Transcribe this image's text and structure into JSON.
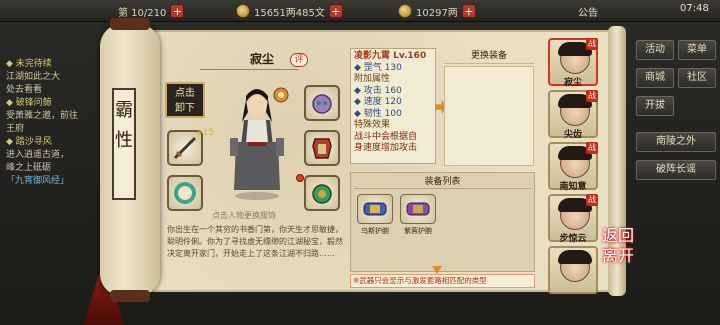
{
  "topbar": {
    "level_text": "第 10/210",
    "silver": "15651两485文",
    "gold": "10297两",
    "announcement": "公告",
    "clock": "07:48"
  },
  "quest_panel": {
    "lines": [
      {
        "text": "◆ 未完待续",
        "cls": "h"
      },
      {
        "text": "江湖如此之大",
        "cls": ""
      },
      {
        "text": "处去看看",
        "cls": ""
      },
      {
        "text": "◆ 破锋问鲸",
        "cls": "h"
      },
      {
        "text": "受萧雅之邀，前往",
        "cls": ""
      },
      {
        "text": "王府",
        "cls": ""
      },
      {
        "text": "◆ 踏沙寻风",
        "cls": "h"
      },
      {
        "text": "进入逍遥古道，",
        "cls": ""
      },
      {
        "text": "峰之上砥砺",
        "cls": ""
      },
      {
        "text": "「九宵御风经」",
        "cls": "hl"
      }
    ]
  },
  "right_menu": {
    "row1": [
      "活动",
      "菜单"
    ],
    "row2": [
      "商城",
      "社区"
    ],
    "btn3": "开拔",
    "side1": "南陵之外",
    "side2": "破阵长谣"
  },
  "character": {
    "vertical_title": "霸性",
    "name": "寂尘",
    "rate_label": "评",
    "unload_label_1": "点击",
    "unload_label_2": "卸下",
    "upgrade_badge": "+15",
    "hint": "点击人物更换服饰",
    "description": "你出生在一个其穷的书香门第，你天生才思敏捷，聪明伶俐。你为了寻找虚无缥缈的江湖秘宝，毅然决定离开家门，开始走上了这条江湖不归路……"
  },
  "item_detail": {
    "title": "凌影九霄 Lv.160",
    "base": "◆ 罡气 130",
    "extra_head": "附加属性",
    "stats": [
      "◆ 攻击 160",
      "◆ 速度 120",
      "◆ 韧性 100"
    ],
    "special_head": "特殊效果",
    "effect_1": "战斗中会根据自",
    "effect_2": "身速度增加攻击"
  },
  "replace": {
    "header": "更换装备"
  },
  "equip_list": {
    "title": "装备列表",
    "items": [
      {
        "name": "乌斯护腕"
      },
      {
        "name": "紫蓉护腕"
      }
    ],
    "note": "※武器只会显示与激发套路相匹配的类型"
  },
  "roster": [
    {
      "name": "寂尘",
      "tag": "战",
      "selected": true
    },
    {
      "name": "尖齿",
      "tag": "战",
      "selected": false
    },
    {
      "name": "南知意",
      "tag": "战",
      "selected": false
    },
    {
      "name": "步惊云",
      "tag": "战",
      "selected": false
    },
    {
      "name": "",
      "tag": "",
      "selected": false
    }
  ],
  "return_btn": "返回离开",
  "colors": {
    "accent_red": "#c52a18",
    "stat_blue": "#2d4e7e",
    "paper": "#e9dfc3"
  }
}
